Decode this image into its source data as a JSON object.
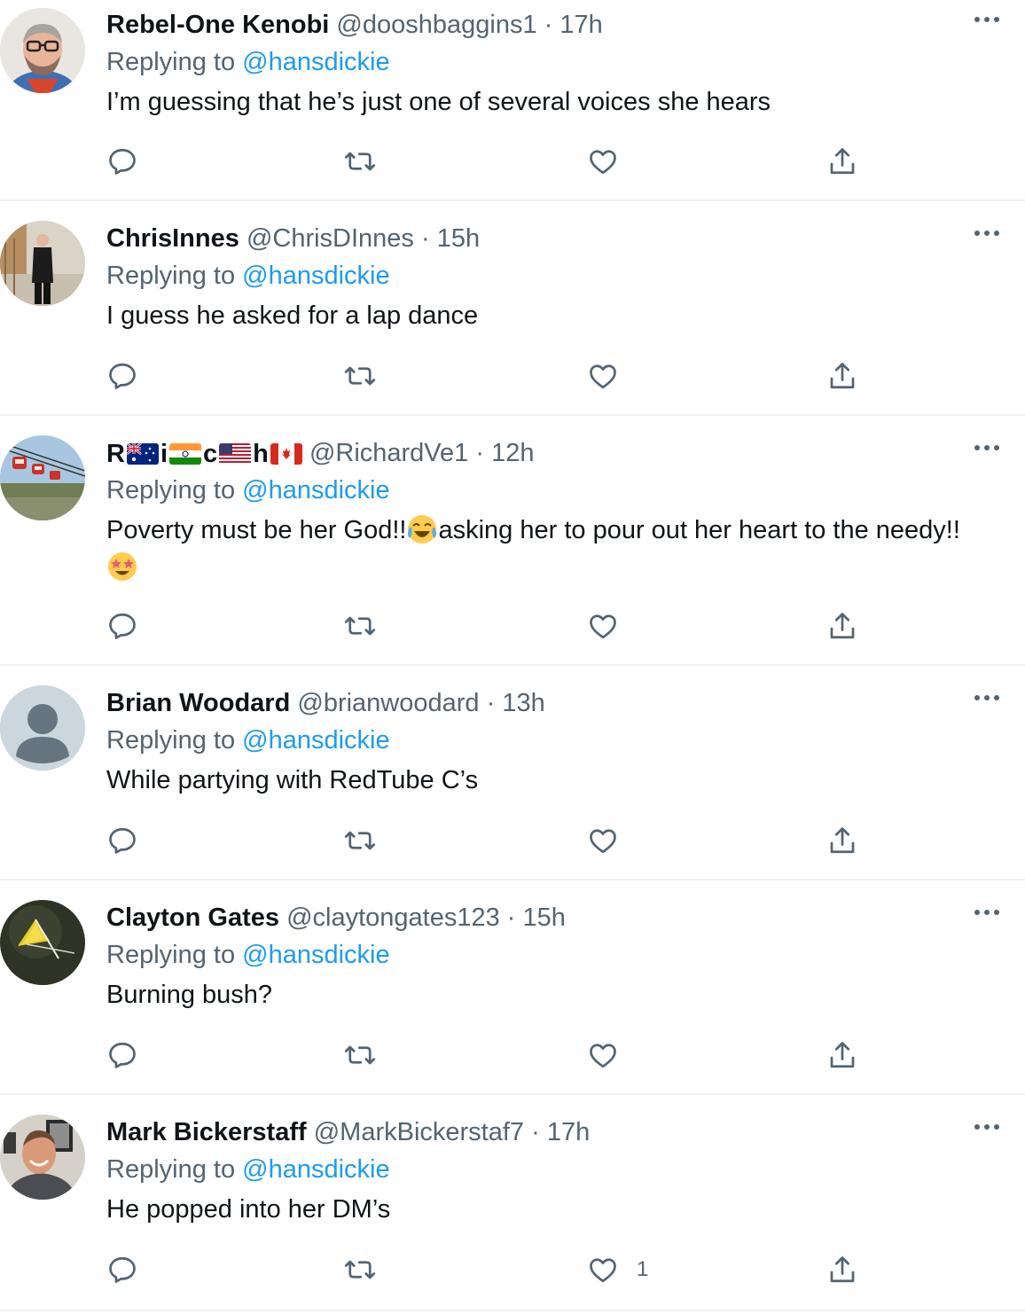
{
  "replying_prefix": "Replying to",
  "tweets": [
    {
      "name": "Rebel-One Kenobi",
      "handle": "@dooshbaggins1",
      "sep": "·",
      "time": "17h",
      "reply_to": "@hansdickie",
      "text": "I’m guessing that he’s just one of several voices she hears",
      "likes": "",
      "avatar": "man-glasses-beard"
    },
    {
      "name": "ChrisInnes",
      "handle": "@ChrisDInnes",
      "sep": "·",
      "time": "15h",
      "reply_to": "@hansdickie",
      "text": "I guess he asked for a lap dance",
      "likes": "",
      "avatar": "man-suit-standing"
    },
    {
      "name_parts": [
        "R",
        "i",
        "c",
        "h"
      ],
      "name_flags": [
        "australia-flag",
        "india-flag",
        "usa-flag",
        "canada-flag"
      ],
      "handle": "@RichardVe1",
      "sep": "·",
      "time": "12h",
      "reply_to": "@hansdickie",
      "text_a": "Poverty must be her God!!",
      "text_b": "asking her to pour out her heart to the needy!!",
      "emojis": [
        "face-with-tears-of-joy",
        "star-struck"
      ],
      "likes": "",
      "avatar": "cable-cars"
    },
    {
      "name": "Brian Woodard",
      "handle": "@brianwoodard",
      "sep": "·",
      "time": "13h",
      "reply_to": "@hansdickie",
      "text": "While partying with RedTube C’s",
      "likes": "",
      "avatar": "default-profile"
    },
    {
      "name": "Clayton Gates",
      "handle": "@claytongates123",
      "sep": "·",
      "time": "15h",
      "reply_to": "@hansdickie",
      "text": "Burning bush?",
      "likes": "",
      "avatar": "yellow-umbrella"
    },
    {
      "name": "Mark Bickerstaff",
      "handle": "@MarkBickerstaf7",
      "sep": "·",
      "time": "17h",
      "reply_to": "@hansdickie",
      "text": "He popped into her DM’s",
      "likes": "1",
      "avatar": "smiling-man"
    }
  ],
  "colors": {
    "link": "#1d9bf0",
    "secondary": "#536471",
    "text": "#0f1419",
    "divider": "#eff3f4"
  },
  "icons": [
    "reply-icon",
    "retweet-icon",
    "like-icon",
    "share-icon",
    "more-icon"
  ]
}
